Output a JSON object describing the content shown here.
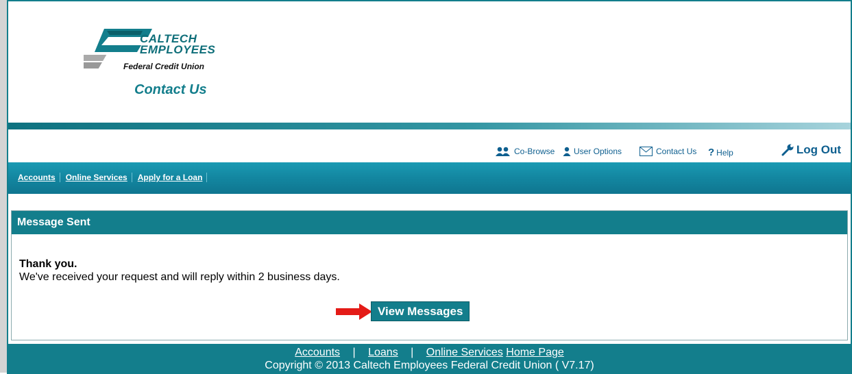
{
  "header": {
    "logo_name": "CALTECH\nEMPLOYEES",
    "logo_sub": "Federal Credit Union",
    "page_title": "Contact Us"
  },
  "utility": {
    "cobrowse": "Co-Browse",
    "user_options": "User Options",
    "contact_us": "Contact Us",
    "help": "Help",
    "logout": "Log Out"
  },
  "nav": {
    "items": [
      {
        "label": "Accounts"
      },
      {
        "label": "Online Services"
      },
      {
        "label": "Apply for a Loan"
      }
    ]
  },
  "panel": {
    "title": "Message Sent",
    "thanks": "Thank you.",
    "message": "We've received your request and will reply within 2 business days.",
    "button": "View Messages"
  },
  "footer": {
    "accounts": "Accounts",
    "loans": "Loans",
    "online_services": "Online Services",
    "home_page": "Home Page",
    "separator": "|",
    "copyright": "Copyright © 2013 Caltech Employees Federal Credit Union ( V7.17)"
  },
  "colors": {
    "teal": "#137e8c",
    "link_blue": "#0e5f8f",
    "arrow_red": "#e41b17"
  },
  "icons": [
    "people-icon",
    "user-icon",
    "envelope-icon",
    "help-icon",
    "wrench-icon",
    "red-arrow-icon"
  ]
}
